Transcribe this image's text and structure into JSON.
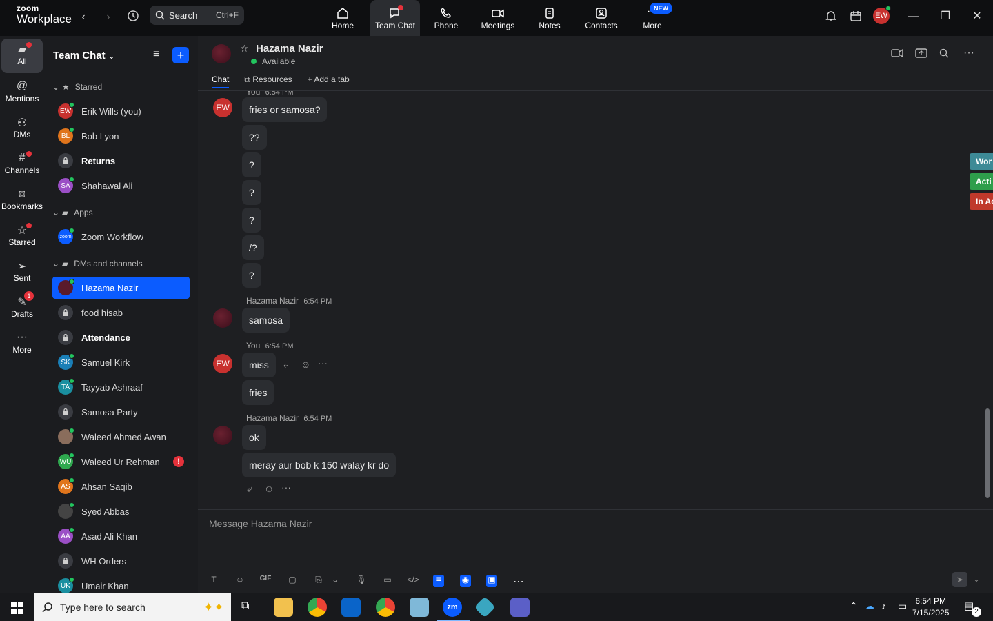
{
  "app": {
    "logo_top": "zoom",
    "logo_bottom": "Workplace"
  },
  "search": {
    "label": "Search",
    "shortcut": "Ctrl+F"
  },
  "nav_tabs": [
    {
      "label": "Home"
    },
    {
      "label": "Team Chat"
    },
    {
      "label": "Phone"
    },
    {
      "label": "Meetings"
    },
    {
      "label": "Notes"
    },
    {
      "label": "Contacts"
    },
    {
      "label": "More",
      "badge": "NEW"
    }
  ],
  "user": {
    "initials": "EW"
  },
  "rail": [
    {
      "label": "All"
    },
    {
      "label": "Mentions"
    },
    {
      "label": "DMs"
    },
    {
      "label": "Channels"
    },
    {
      "label": "Bookmarks"
    },
    {
      "label": "Starred"
    },
    {
      "label": "Sent"
    },
    {
      "label": "Drafts",
      "badge": "1"
    },
    {
      "label": "More"
    }
  ],
  "sidebar": {
    "title": "Team Chat",
    "sections": {
      "starred": "Starred",
      "apps": "Apps",
      "dms": "DMs and channels"
    },
    "starred": [
      {
        "name": "Erik Wills (you)",
        "initials": "EW",
        "color": "#c8312f"
      },
      {
        "name": "Bob Lyon",
        "initials": "BL",
        "color": "#e0751c"
      },
      {
        "name": "Returns",
        "initials": "",
        "color": "#3a3c42"
      },
      {
        "name": "Shahawal Ali",
        "initials": "SA",
        "color": "#9b4fc6"
      }
    ],
    "apps": [
      {
        "name": "Zoom Workflow",
        "initials": "zoom",
        "color": "#0b5cff"
      }
    ],
    "dms": [
      {
        "name": "Hazama Nazir",
        "initials": "",
        "color": "#5a1a2a"
      },
      {
        "name": "food hisab",
        "initials": "",
        "color": "#3a3c42"
      },
      {
        "name": "Attendance",
        "initials": "",
        "color": "#3a3c42"
      },
      {
        "name": "Samuel Kirk",
        "initials": "SK",
        "color": "#1a7fb7"
      },
      {
        "name": "Tayyab Ashraaf",
        "initials": "TA",
        "color": "#1a8fa0"
      },
      {
        "name": "Samosa Party",
        "initials": "",
        "color": "#3a3c42"
      },
      {
        "name": "Waleed Ahmed Awan",
        "initials": "",
        "color": "#8a6d5c"
      },
      {
        "name": "Waleed Ur Rehman",
        "initials": "WU",
        "color": "#2fa84f"
      },
      {
        "name": "Ahsan Saqib",
        "initials": "AS",
        "color": "#e0751c"
      },
      {
        "name": "Syed Abbas",
        "initials": "",
        "color": "#444"
      },
      {
        "name": "Asad Ali Khan",
        "initials": "AA",
        "color": "#9b4fc6"
      },
      {
        "name": "WH Orders",
        "initials": "",
        "color": "#3a3c42"
      },
      {
        "name": "Umair Khan",
        "initials": "UK",
        "color": "#1a8fa0"
      }
    ]
  },
  "chat": {
    "name": "Hazama Nazir",
    "status": "Available",
    "tabs": [
      "Chat",
      "Resources",
      "Add a tab"
    ],
    "compose_placeholder": "Message Hazama Nazir"
  },
  "messages": [
    {
      "sender": "You",
      "time": "6:54 PM",
      "avatar": "EW",
      "texts": [
        "fries or samosa?",
        "??",
        "?",
        "?",
        "?",
        "/?",
        "?"
      ]
    },
    {
      "sender": "Hazama Nazir",
      "time": "6:54 PM",
      "texts": [
        "samosa"
      ]
    },
    {
      "sender": "You",
      "time": "6:54 PM",
      "avatar": "EW",
      "texts": [
        "miss",
        "fries"
      ]
    },
    {
      "sender": "Hazama Nazir",
      "time": "6:54 PM",
      "texts": [
        "ok",
        "meray aur bob k 150 walay kr do"
      ]
    }
  ],
  "right_tags": [
    {
      "label": "Wor",
      "color": "#3d8a96"
    },
    {
      "label": "Acti",
      "color": "#2e9e4b"
    },
    {
      "label": "In Ac",
      "color": "#c0392b"
    }
  ],
  "compose_tools": [
    "T",
    "☺",
    "GIF",
    "▢",
    "⎘",
    "⌄",
    "🎙",
    "▭",
    "</>",
    "≣",
    "◉",
    "▣",
    "⋯"
  ],
  "taskbar": {
    "search_placeholder": "Type here to search",
    "time": "6:54 PM",
    "date": "7/15/2025",
    "notifications": "2"
  }
}
